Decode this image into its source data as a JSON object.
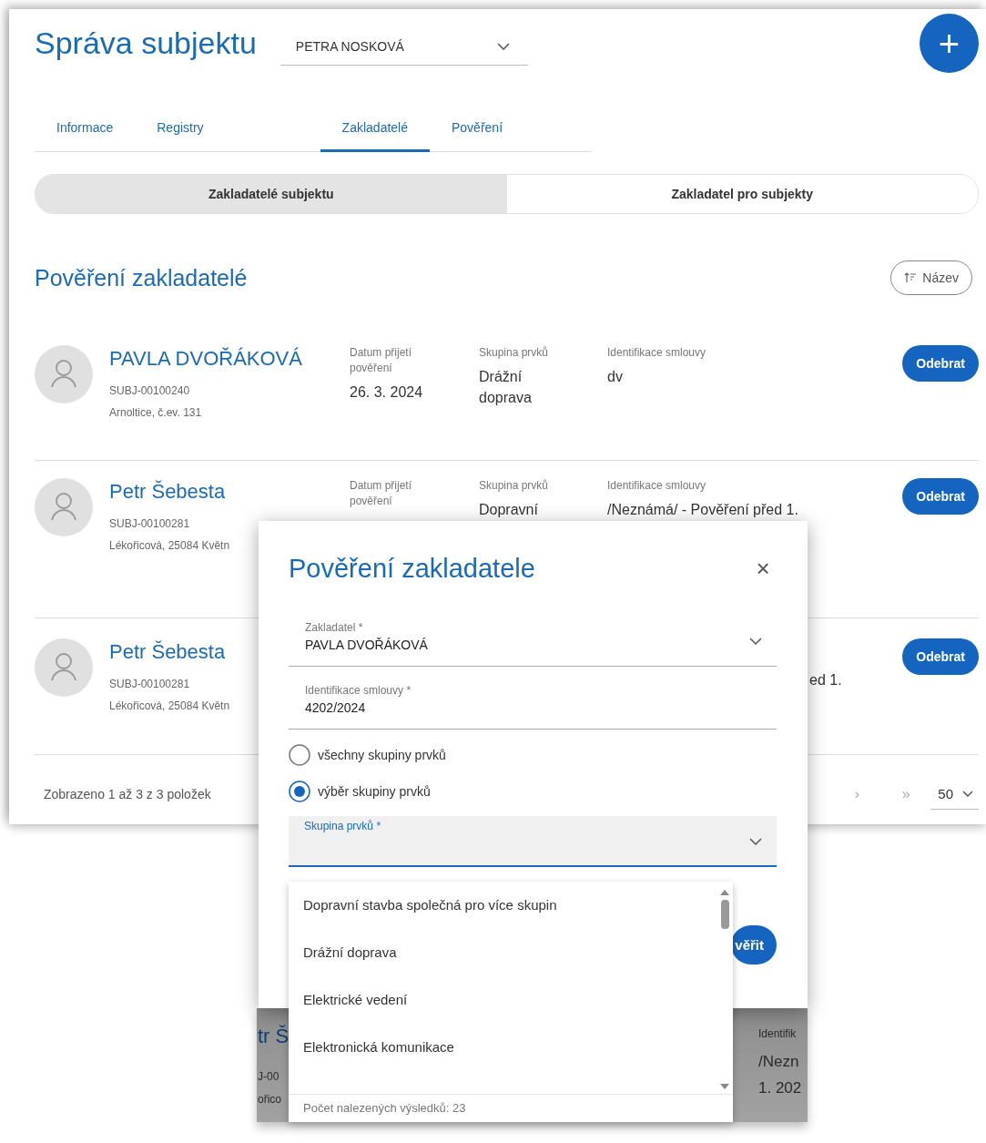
{
  "header": {
    "title": "Správa subjektu",
    "subject_select": {
      "value": "PETRA NOSKOVÁ"
    },
    "add_button": "+"
  },
  "tabs": [
    {
      "label": "Informace",
      "selected": false
    },
    {
      "label": "Registry",
      "selected": false
    },
    {
      "label": "Zakladatelé",
      "selected": true
    },
    {
      "label": "Pověření",
      "selected": false
    }
  ],
  "segments": [
    {
      "label": "Zakladatelé subjektu",
      "selected": true
    },
    {
      "label": "Zakladatel pro subjekty",
      "selected": false
    }
  ],
  "section": {
    "title": "Pověření zakladatelé",
    "sort_button": "Název"
  },
  "rows": [
    {
      "name": "PAVLA DVOŘÁKOVÁ",
      "subject_id": "SUBJ-00100240",
      "address": "Arnoltice, č.ev. 131",
      "date_label": "Datum přijetí pověření",
      "date": "26. 3. 2024",
      "group_label": "Skupina prvků",
      "group": "Drážní doprava",
      "contract_label": "Identifikace smlouvy",
      "contract_id": "dv",
      "button": "Odebrat"
    },
    {
      "name": "Petr Šebesta",
      "subject_id": "SUBJ-00100281",
      "address": "Lékořicová, 25084 Květn",
      "date_label": "Datum přijetí pověření",
      "group_label": "Skupina prvků",
      "group": "Dopravní",
      "contract_label": "Identifikace smlouvy",
      "contract_id": "/Neznámá/ - Pověření před 1.",
      "button": "Odebrat"
    },
    {
      "name": "Petr Šebesta",
      "subject_id": "SUBJ-00100281",
      "address": "Lékořicová, 25084 Květn",
      "contract_id": "ed 1.",
      "contract_cut_left": true,
      "button": "Odebrat"
    }
  ],
  "pagination": {
    "summary": "Zobrazeno 1 až 3 z 3 položek",
    "next": "›",
    "last": "»",
    "page_size": "50"
  },
  "dialog": {
    "title": "Pověření zakladatele",
    "close": "×",
    "fields": [
      {
        "label": "Zakladatel *",
        "value": "PAVLA DVOŘÁKOVÁ",
        "kind": "select"
      },
      {
        "label": "Identifikace smlouvy *",
        "value": "4202/2024",
        "kind": "text"
      }
    ],
    "radios": [
      {
        "label": "všechny skupiny prvků",
        "selected": false
      },
      {
        "label": "výběr skupiny prvků",
        "selected": true
      }
    ],
    "group_select": {
      "label": "Skupina prvků *"
    },
    "confirm_button": "věřit",
    "options": [
      "Dopravní stavba společná pro více skupin",
      "Drážní doprava",
      "Elektrické vedení",
      "Elektronická komunikace"
    ],
    "results_count": "Počet nalezených výsledků: 23"
  },
  "backdrop": {
    "name": "tr Š",
    "subject_id": "J-00",
    "address": "ořico",
    "contract_label": "Identifik",
    "contract_line1": "/Nezn",
    "contract_line2": "1. 202"
  }
}
